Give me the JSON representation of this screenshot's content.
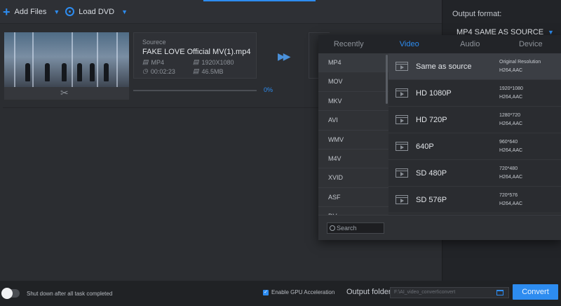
{
  "toolbar": {
    "add_files": "Add Files",
    "load_dvd": "Load DVD"
  },
  "output_format": {
    "label": "Output format:",
    "value": "MP4 SAME AS SOURCE"
  },
  "task": {
    "source_label": "Sourece",
    "filename": "FAKE LOVE Official MV(1).mp4",
    "container": "MP4",
    "resolution": "1920X1080",
    "duration": "00:02:23",
    "size": "46.5MB",
    "progress_text": "0%",
    "progress": 0
  },
  "format_panel": {
    "tabs": [
      "Recently",
      "Video",
      "Audio",
      "Device"
    ],
    "active_tab": "Video",
    "categories": [
      "MP4",
      "MOV",
      "MKV",
      "AVI",
      "WMV",
      "M4V",
      "XVID",
      "ASF",
      "DV"
    ],
    "options": [
      {
        "name": "Same as source",
        "meta1": "Original Resolution",
        "meta2": "H264,AAC"
      },
      {
        "name": "HD 1080P",
        "meta1": "1920*1080",
        "meta2": "H264,AAC"
      },
      {
        "name": "HD 720P",
        "meta1": "1280*720",
        "meta2": "H264,AAC"
      },
      {
        "name": "640P",
        "meta1": "960*640",
        "meta2": "H264,AAC"
      },
      {
        "name": "SD 480P",
        "meta1": "720*480",
        "meta2": "H264,AAC"
      },
      {
        "name": "SD 576P",
        "meta1": "720*576",
        "meta2": "H264,AAC"
      }
    ],
    "search_placeholder": "Search"
  },
  "bottom": {
    "shutdown_label": "Shut down after all task completed",
    "gpu_label": "Enable GPU Acceleration",
    "output_folder_label": "Output folder:",
    "output_folder_path": "F:\\AI_video_convert\\convert",
    "convert_label": "Convert"
  },
  "colors": {
    "accent": "#2d8cf0",
    "background": "#2b2d31",
    "panel": "#222428"
  },
  "icons": [
    "plus-icon",
    "disc-icon",
    "scissors-icon",
    "arrow-icon",
    "search-icon",
    "folder-icon",
    "video-icon"
  ]
}
